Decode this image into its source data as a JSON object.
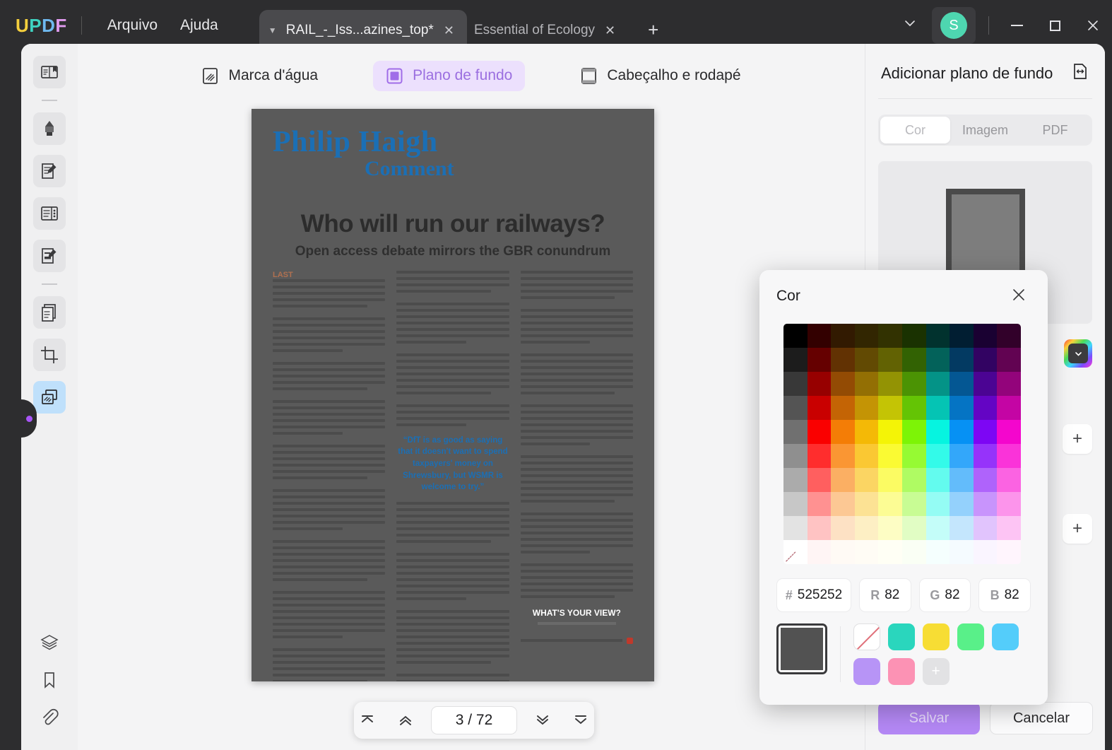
{
  "app": {
    "logo": "UPDF",
    "menus": [
      "Arquivo",
      "Ajuda"
    ]
  },
  "tabs": [
    {
      "label": "RAIL_-_Iss...azines_top*",
      "active": true,
      "close": "✕",
      "caret": "▼"
    },
    {
      "label": "Essential of Ecology",
      "active": false,
      "close": "✕"
    }
  ],
  "titlebar": {
    "new_tab": "+",
    "chevron": "⌄",
    "avatar_initial": "S",
    "avatar_color": "#4ed6b0",
    "minimize": "—",
    "maximize": "☐",
    "close": "✕"
  },
  "tooltabs": [
    {
      "label": "Marca d'água",
      "icon": "watermark-icon",
      "active": false
    },
    {
      "label": "Plano de fundo",
      "icon": "background-icon",
      "active": true
    },
    {
      "label": "Cabeçalho e rodapé",
      "icon": "header-footer-icon",
      "active": false
    }
  ],
  "sidebar": {
    "items": [
      {
        "name": "reader-icon",
        "active": false
      },
      {
        "name": "highlighter-icon",
        "active": false
      },
      {
        "name": "edit-text-icon",
        "active": false
      },
      {
        "name": "organize-pages-icon",
        "active": false
      },
      {
        "name": "form-icon",
        "active": false
      },
      {
        "name": "page-tools-icon",
        "active": false
      },
      {
        "name": "crop-icon",
        "active": false
      },
      {
        "name": "background-watermark-icon",
        "active": true
      }
    ],
    "bottom_items": [
      {
        "name": "layers-icon"
      },
      {
        "name": "bookmark-icon"
      },
      {
        "name": "attachment-icon"
      }
    ]
  },
  "document": {
    "byline_line1": "Philip Haigh",
    "byline_line2": "Comment",
    "headline": "Who will run our railways?",
    "subhead": "Open access debate mirrors the GBR conundrum",
    "pullquote": "“DfT is as good as saying that it doesn't want to spend taxpayers' money on Shrewsbury, but WSMR is welcome to try.”",
    "your_view": "WHAT'S YOUR VIEW?"
  },
  "pagenav": {
    "first": "first-page",
    "prev": "prev-page",
    "value": "3 / 72",
    "next": "next-page",
    "last": "last-page"
  },
  "right_panel": {
    "title": "Adicionar plano de fundo",
    "segments": [
      {
        "label": "Cor",
        "active": true
      },
      {
        "label": "Imagem",
        "active": false
      },
      {
        "label": "PDF",
        "active": false
      }
    ],
    "add_button": "+",
    "save_label": "Salvar",
    "cancel_label": "Cancelar",
    "save_color": "#b488f5"
  },
  "color_dialog": {
    "title": "Cor",
    "close": "✕",
    "hex_prefix": "#",
    "hex_value": "525252",
    "r_prefix": "R",
    "r_value": "82",
    "g_prefix": "G",
    "g_value": "82",
    "b_prefix": "B",
    "b_value": "82",
    "current_color": "#525252",
    "recent_swatches": [
      {
        "name": "no-color",
        "hex": "none"
      },
      {
        "name": "teal",
        "hex": "#2ad6bd"
      },
      {
        "name": "yellow",
        "hex": "#f7dd34"
      },
      {
        "name": "green",
        "hex": "#59f089"
      },
      {
        "name": "sky-blue",
        "hex": "#54cdfa"
      },
      {
        "name": "lavender",
        "hex": "#b794f6"
      },
      {
        "name": "pink",
        "hex": "#fc92b4"
      },
      {
        "name": "add-swatch",
        "hex": "add"
      }
    ],
    "grid_columns": 10,
    "grid_rows": 10,
    "grid_hues": [
      0,
      0,
      30,
      45,
      60,
      90,
      175,
      205,
      270,
      310
    ],
    "grid_is_gray_column": [
      true,
      false,
      false,
      false,
      false,
      false,
      false,
      false,
      false,
      false
    ],
    "selected_cell": {
      "col": 0,
      "row": 9
    }
  }
}
